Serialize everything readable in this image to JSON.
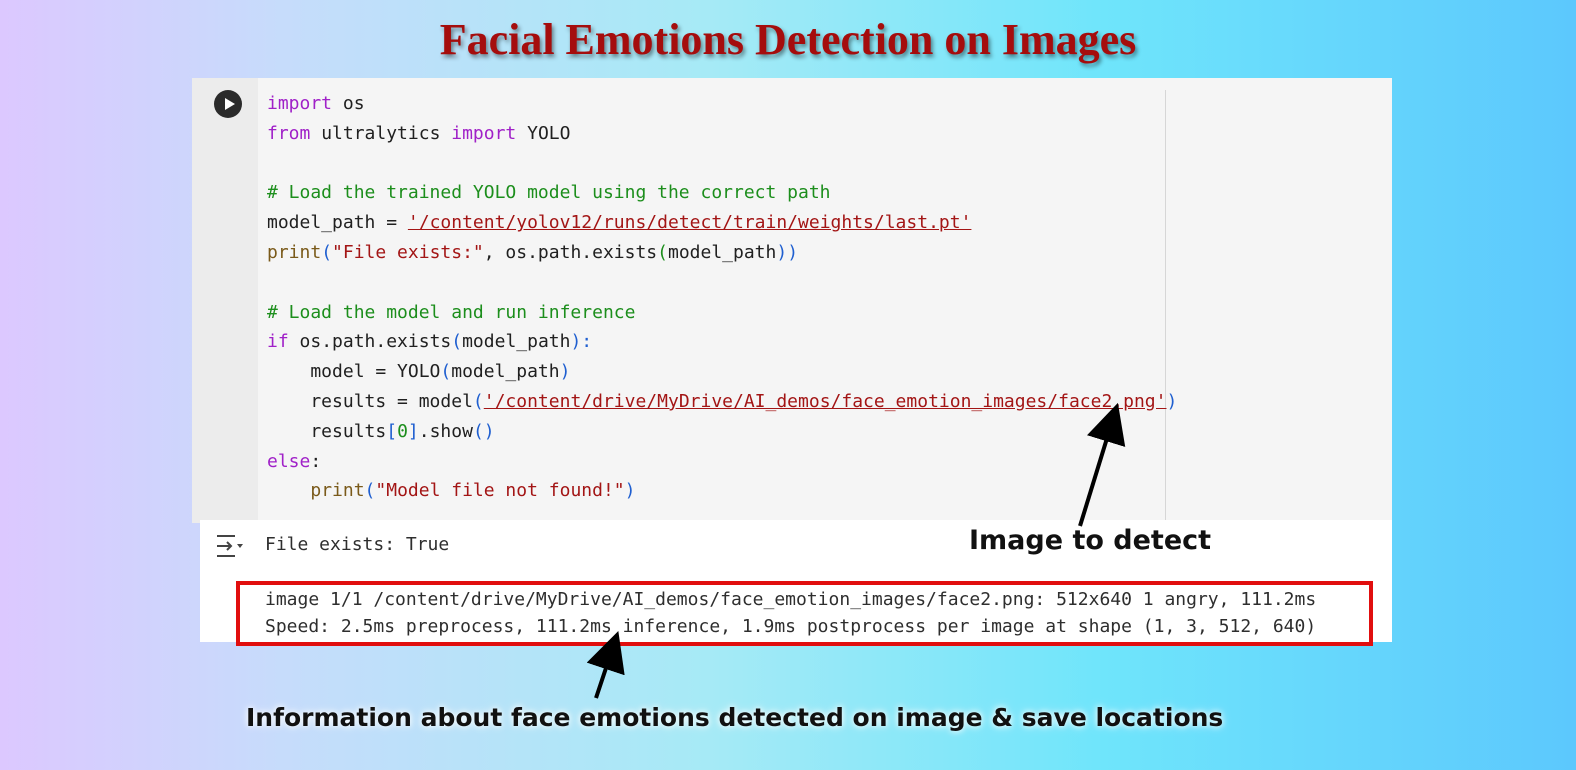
{
  "title": "Facial Emotions Detection on Images",
  "code_lines": {
    "l1": [
      "import",
      " os"
    ],
    "l2": [
      "from",
      " ultralytics ",
      "import",
      " YOLO"
    ],
    "l4": "# Load the trained YOLO model using the correct path",
    "l5": [
      "model_path = ",
      "'/content/yolov12/runs/detect/train/weights/last.pt'"
    ],
    "l6": [
      "print",
      "(",
      "\"File exists:\"",
      ", os.path.exists",
      "(",
      "model_path",
      "))"
    ],
    "l8": "# Load the model and run inference",
    "l9": [
      "if",
      " os.path.exists",
      "(",
      "model_path",
      "):"
    ],
    "l10": [
      "    model = YOLO",
      "(",
      "model_path",
      ")"
    ],
    "l11": [
      "    results = model",
      "(",
      "'/content/drive/MyDrive/AI_demos/face_emotion_images/face2.png'",
      ")"
    ],
    "l12": [
      "    results",
      "[",
      "0",
      "]",
      ".show",
      "()"
    ],
    "l13": [
      "else",
      ":"
    ],
    "l14": [
      "    ",
      "print",
      "(",
      "\"Model file not found!\"",
      ")"
    ]
  },
  "output": {
    "line1": "File exists: True",
    "line2": "image 1/1 /content/drive/MyDrive/AI_demos/face_emotion_images/face2.png: 512x640 1 angry, 111.2ms",
    "line3": "Speed: 2.5ms preprocess, 111.2ms inference, 1.9ms postprocess per image at shape (1, 3, 512, 640)"
  },
  "annotations": {
    "image_to_detect": "Image to detect",
    "info": "Information about face emotions detected on image & save locations"
  },
  "icons": {
    "run": "play-icon",
    "output": "output-toggle-icon"
  },
  "colors": {
    "title": "#a50d0d",
    "highlight_box": "#e10e0e",
    "keyword": "#a021c8",
    "comment": "#1c8e1c",
    "string": "#a31515"
  }
}
